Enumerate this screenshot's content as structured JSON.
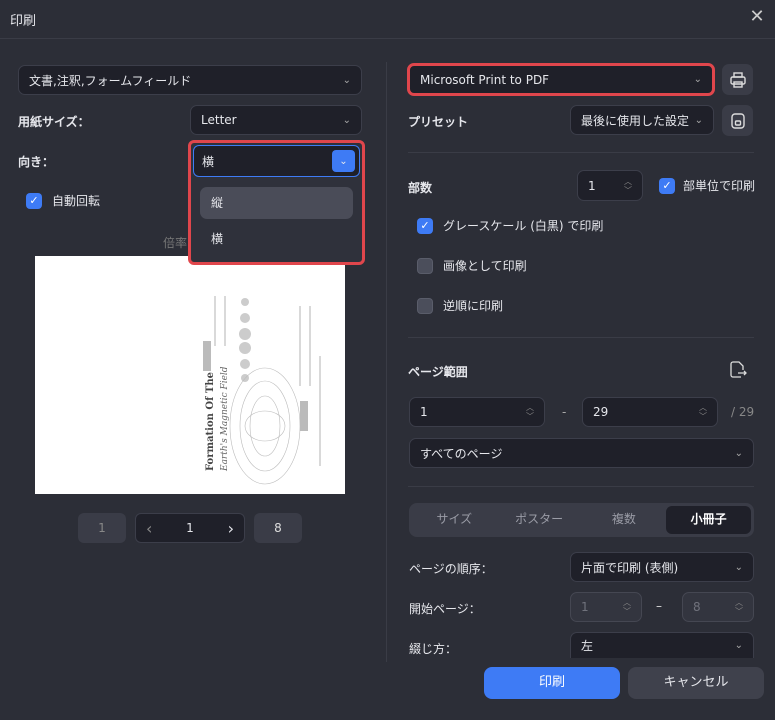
{
  "dialog": {
    "title": "印刷"
  },
  "left": {
    "content_select": "文書,注釈,フォームフィールド",
    "paper_size_label": "用紙サイズ：",
    "paper_size": "Letter",
    "orientation_label": "向き：",
    "orientation": "横",
    "orientation_options": [
      "縦",
      "横"
    ],
    "auto_rotate_label": "自動回転",
    "auto_rotate": true,
    "scale_label": "倍率",
    "preview": {
      "title_line1": "Formation Of The",
      "title_line2": "Earth's Magnetic Field"
    },
    "pager": {
      "first": "1",
      "current": "1",
      "last": "8",
      "prev": "‹",
      "next": "›"
    }
  },
  "right": {
    "printer": "Microsoft Print to PDF",
    "preset_label": "プリセット",
    "preset": "最後に使用した設定",
    "copies_label": "部数",
    "copies": "1",
    "collate_label": "部単位で印刷",
    "collate": true,
    "grayscale_label": "グレースケール (白黒) で印刷",
    "grayscale": true,
    "as_image_label": "画像として印刷",
    "as_image": false,
    "reverse_label": "逆順に印刷",
    "reverse": false,
    "page_range_label": "ページ範囲",
    "range_from": "1",
    "range_dash": "-",
    "range_to": "29",
    "range_total": "/ 29",
    "range_select": "すべてのページ",
    "tabs": [
      "サイズ",
      "ポスター",
      "複数",
      "小冊子"
    ],
    "active_tab": "小冊子",
    "page_order_label": "ページの順序：",
    "page_order": "片面で印刷 (表側)",
    "start_page_label": "開始ページ：",
    "start_from": "1",
    "start_dash": "–",
    "start_to": "8",
    "binding_label": "綴じ方：",
    "binding": "左"
  },
  "footer": {
    "print": "印刷",
    "cancel": "キャンセル"
  },
  "colors": {
    "accent": "#3e7bf5",
    "highlight": "#e0464c"
  }
}
